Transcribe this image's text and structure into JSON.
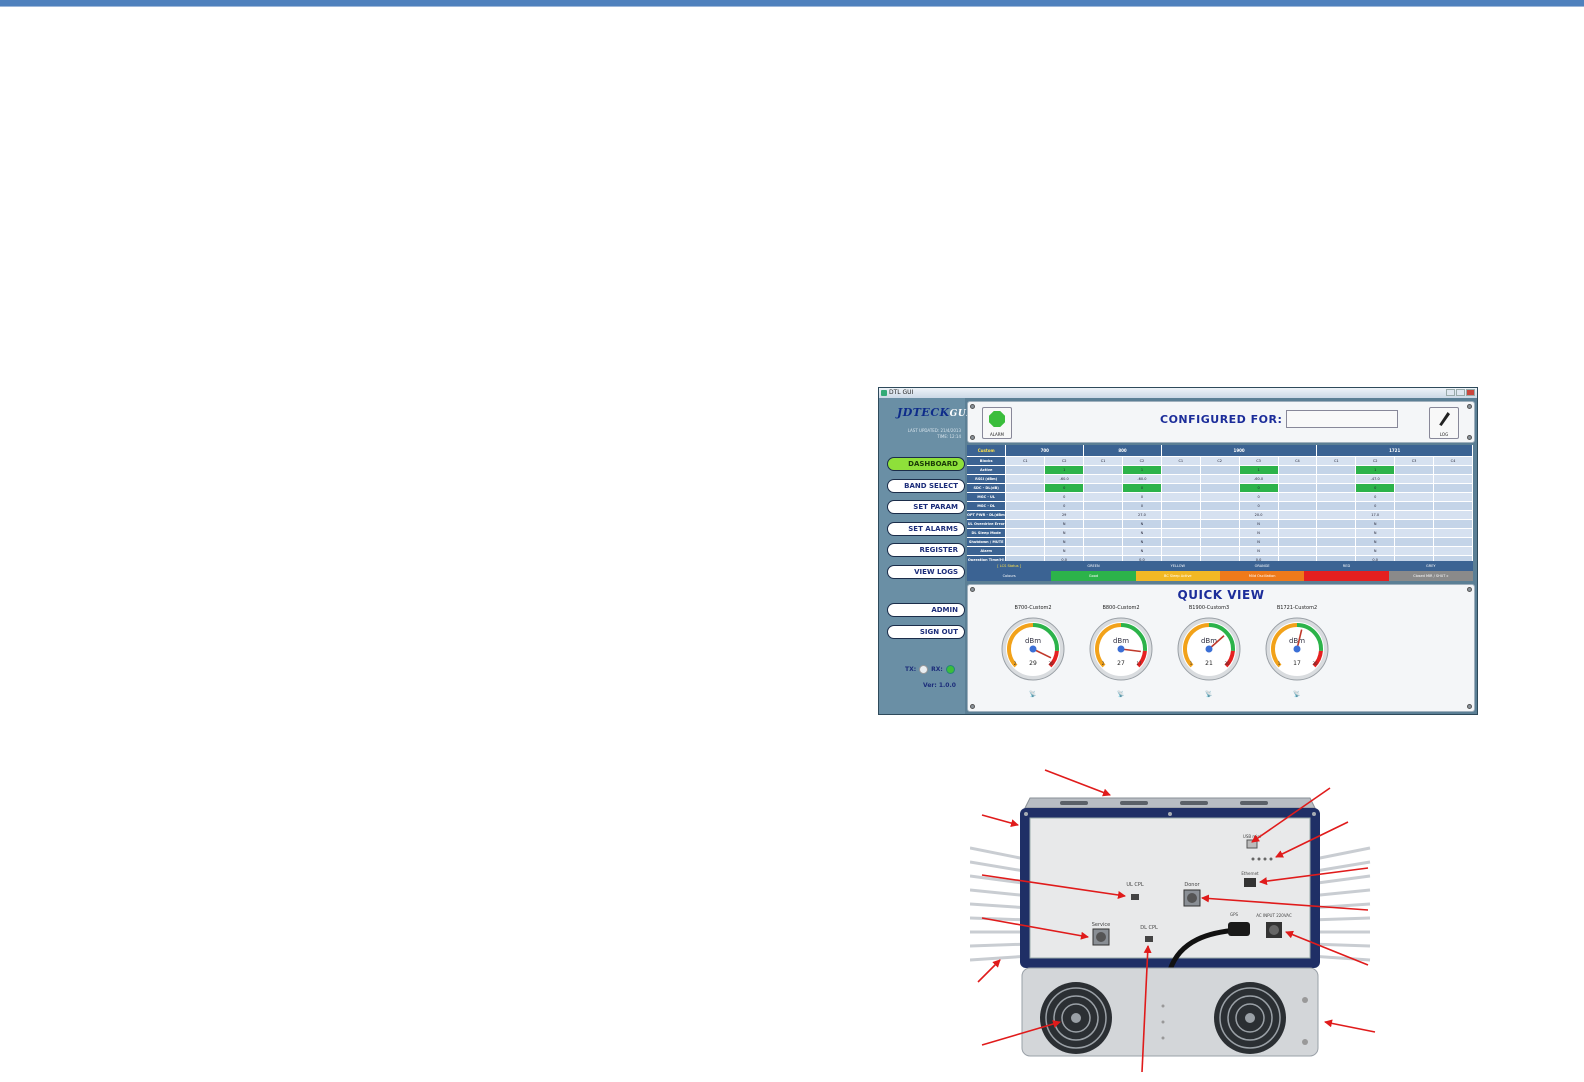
{
  "gui": {
    "window_title": "DTL GUI",
    "logo_main": "JDTECK",
    "logo_sub": "GUI",
    "last_updated": "LAST UPDATED: 21/4/2013",
    "time_line": "TIME: 12:14",
    "nav": [
      "DASHBOARD",
      "BAND SELECT",
      "SET PARAM",
      "SET ALARMS",
      "REGISTER",
      "VIEW LOGS"
    ],
    "admin": "ADMIN",
    "signout": "SIGN OUT",
    "tx_label": "TX:",
    "rx_label": "RX:",
    "version": "Ver: 1.0.0",
    "alarm_label": "ALARM",
    "log_label": "LOG",
    "configured_for": "CONFIGURED FOR:",
    "quick_view": "QUICK VIEW",
    "colors": {
      "active_nav": "#8ee03a",
      "title_blue": "#1c2d9a",
      "green": "#2cb34a"
    }
  },
  "table": {
    "corner": "Custom",
    "bands": [
      "700",
      "800",
      "1900",
      "1721"
    ],
    "band_channels": [
      2,
      2,
      4,
      4
    ],
    "channels": [
      "C1",
      "C2",
      "C1",
      "C2",
      "C1",
      "C2",
      "C3",
      "C4",
      "C1",
      "C2",
      "C3",
      "C4"
    ],
    "row_labels": [
      "Blocks",
      "Active",
      "RSSI (dBm)",
      "SDC - DL(dB)",
      "MGC - UL",
      "MGC - DL",
      "OPT PWR - DL(dBm)",
      "UL Overdrive Error",
      "DL Sleep Mode",
      "Shutdown / MUTE",
      "Alarm",
      "Operation Time(H)"
    ],
    "cells": [
      [
        "",
        "",
        "",
        "",
        "",
        "",
        "",
        "",
        "",
        "",
        "",
        ""
      ],
      [
        "",
        "1",
        "",
        "1",
        "",
        "",
        "1",
        "",
        "",
        "1",
        "",
        ""
      ],
      [
        "",
        "-60.0",
        "",
        "-60.0",
        "",
        "",
        "-60.0",
        "",
        "",
        "-47.0",
        "",
        ""
      ],
      [
        "",
        "0",
        "",
        "0",
        "",
        "",
        "0",
        "",
        "",
        "0",
        "",
        ""
      ],
      [
        "",
        "0",
        "",
        "0",
        "",
        "",
        "0",
        "",
        "",
        "0",
        "",
        ""
      ],
      [
        "",
        "0",
        "",
        "0",
        "",
        "",
        "0",
        "",
        "",
        "0",
        "",
        ""
      ],
      [
        "",
        "29",
        "",
        "27.0",
        "",
        "",
        "20.0",
        "",
        "",
        "17.0",
        "",
        ""
      ],
      [
        "",
        "N",
        "",
        "N",
        "",
        "",
        "N",
        "",
        "",
        "N",
        "",
        ""
      ],
      [
        "",
        "N",
        "",
        "N",
        "",
        "",
        "N",
        "",
        "",
        "N",
        "",
        ""
      ],
      [
        "",
        "N",
        "",
        "N",
        "",
        "",
        "N",
        "",
        "",
        "N",
        "",
        ""
      ],
      [
        "",
        "N",
        "",
        "N",
        "",
        "",
        "N",
        "",
        "",
        "N",
        "",
        ""
      ],
      [
        "",
        "0.0",
        "",
        "0.0",
        "",
        "",
        "0.0",
        "",
        "",
        "0.0",
        "",
        ""
      ]
    ]
  },
  "legend": {
    "heads": [
      "[ LCS Status ]",
      "GREEN",
      "YELLOW",
      "ORANGE",
      "RED",
      "GREY"
    ],
    "values": [
      "Colours",
      "Good",
      "BC Sleep Active",
      "Mild Oscillation",
      "",
      "Closed MIR / SHUT c"
    ],
    "colors": [
      "#3b6393",
      "#2cb34a",
      "#f2b824",
      "#ef7a1a",
      "#e52020",
      "#8a8a8a"
    ]
  },
  "gauges": [
    {
      "name": "B700-Custom2",
      "unit": "dBm",
      "value": "29",
      "ticks": [
        "2",
        "30"
      ],
      "level": 0.93
    },
    {
      "name": "B800-Custom2",
      "unit": "dBm",
      "value": "27",
      "ticks": [
        "2",
        "17"
      ],
      "level": 0.86
    },
    {
      "name": "B1900-Custom3",
      "unit": "dBm",
      "value": "21",
      "ticks": [
        "1",
        "30"
      ],
      "level": 0.68
    },
    {
      "name": "B1721-Custom2",
      "unit": "dBm",
      "value": "17",
      "ticks": [
        "1",
        "30"
      ],
      "level": 0.55
    }
  ],
  "device": {
    "labels": {
      "ul_cpl": "UL CPL",
      "donor": "Donor",
      "service": "Service",
      "dl_cpl": "DL CPL",
      "usb": "USB mini",
      "ethernet": "Ethernet",
      "ac_input": "AC INPUT 220VAC",
      "gps": "GPS"
    }
  }
}
